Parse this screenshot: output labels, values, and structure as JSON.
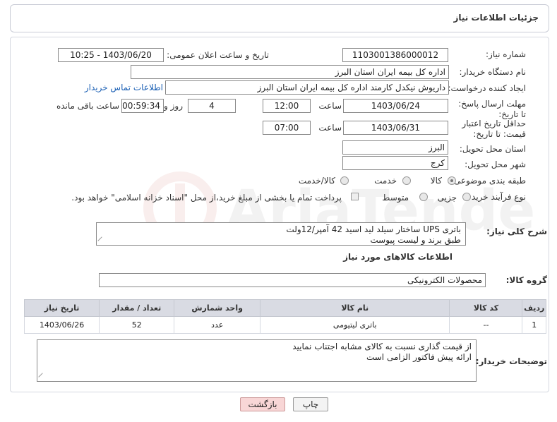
{
  "header": {
    "title": "جزئیات اطلاعات نیاز"
  },
  "form": {
    "need_number": {
      "label": "شماره نیاز:",
      "value": "1103001386000012"
    },
    "announce_datetime": {
      "label": "تاریخ و ساعت اعلان عمومی:",
      "value": "1403/06/20 - 10:25"
    },
    "buyer_org": {
      "label": "نام دستگاه خریدار:",
      "value": "اداره کل بیمه ایران استان البرز"
    },
    "requester": {
      "label": "ایجاد کننده درخواست:",
      "value": "داریوش  نیکدل کارمند  اداره کل بیمه ایران استان البرز",
      "contact_link": "اطلاعات تماس خریدار"
    },
    "reply_deadline": {
      "label": "مهلت ارسال پاسخ: تا تاریخ:",
      "date": "1403/06/24",
      "time_label": "ساعت",
      "time": "12:00",
      "days": "4",
      "days_label": "روز و",
      "remaining": "00:59:34",
      "remaining_label": "ساعت باقی مانده"
    },
    "price_validity": {
      "label": "حداقل تاریخ اعتبار قیمت: تا تاریخ:",
      "date": "1403/06/31",
      "time_label": "ساعت",
      "time": "07:00"
    },
    "delivery_province": {
      "label": "استان محل تحویل:",
      "value": "البرز"
    },
    "delivery_city": {
      "label": "شهر محل تحویل:",
      "value": "کرج"
    },
    "category": {
      "label": "طبقه بندی موضوعی:",
      "options": [
        "کالا",
        "خدمت",
        "کالا/خدمت"
      ],
      "selected": "کالا"
    },
    "purchase_type": {
      "label": "نوع فرآیند خرید :",
      "options": [
        "جزیی",
        "متوسط"
      ],
      "note": "پرداخت تمام یا بخشی از مبلغ خرید،از محل \"اسناد خزانه اسلامی\" خواهد بود."
    }
  },
  "description": {
    "label": "شرح کلی نیاز:",
    "line1": "باتری UPS ساختار سیلد لید اسید 42 آمپر/12ولت",
    "line2": "طبق برند و لیست پیوست"
  },
  "goods_section": {
    "title": "اطلاعات کالاهای مورد نیاز",
    "group_label": "گروه کالا:",
    "group_value": "محصولات الکترونیکی"
  },
  "table": {
    "headers": [
      "ردیف",
      "کد کالا",
      "نام کالا",
      "واحد شمارش",
      "تعداد / مقدار",
      "تاریخ نیاز"
    ],
    "rows": [
      {
        "row": "1",
        "code": "--",
        "name": "باتری لیتیومی",
        "unit": "عدد",
        "qty": "52",
        "date": "1403/06/26"
      }
    ]
  },
  "buyer_notes": {
    "label": "توضیحات خریدار:",
    "line1": "از قیمت گذاری نسبت به کالای مشابه اجتناب نمایید",
    "line2": "ارائه پیش فاکتور الزامی است"
  },
  "buttons": {
    "print": "چاپ",
    "back": "بازگشت"
  },
  "colors": {
    "link": "#1a5fb4",
    "table_header": "#d9dbe3",
    "back_button": "#f8d6d6"
  }
}
